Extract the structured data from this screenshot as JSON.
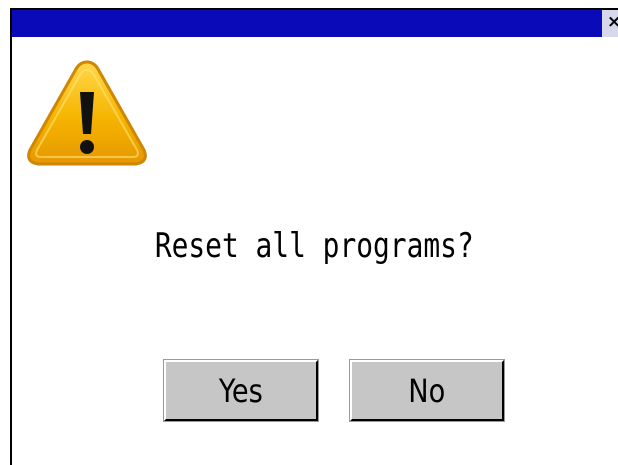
{
  "dialog": {
    "title": "",
    "close_glyph": "×",
    "icon": "warning-icon",
    "message": "Reset all programs?",
    "buttons": {
      "yes_label": "Yes",
      "no_label": "No"
    }
  },
  "colors": {
    "titlebar": "#0a0ab8",
    "button_face": "#c6c6c6",
    "warning_fill": "#f5b800",
    "warning_outline": "#d98a00"
  }
}
